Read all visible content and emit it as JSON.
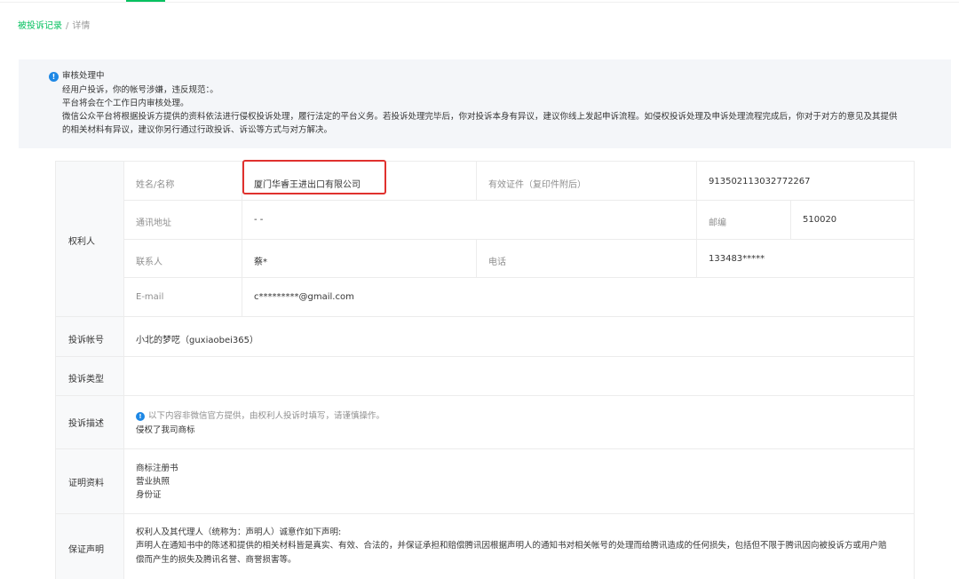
{
  "breadcrumb": {
    "parent": "被投诉记录",
    "separator": "/",
    "current": "详情"
  },
  "notice": {
    "status_title": "审核处理中",
    "line1": "经用户投诉，你的帐号涉嫌，违反规范：。",
    "line2": "平台将会在个工作日内审核处理。",
    "line3": "微信公众平台将根据投诉方提供的资料依法进行侵权投诉处理，履行法定的平台义务。若投诉处理完毕后，你对投诉本身有异议，建议你线上发起申诉流程。如侵权投诉处理及申诉处理流程完成后，你对于对方的意见及其提供",
    "line4": "的相关材料有异议，建议你另行通过行政投诉、诉讼等方式与对方解决。"
  },
  "rights_holder": {
    "section_label": "权利人",
    "name_label": "姓名/名称",
    "name_value": "厦门华睿王进出口有限公司",
    "cert_label": "有效证件（复印件附后）",
    "cert_value": "913502113032772267",
    "address_label": "通讯地址",
    "address_value": "- -",
    "postcode_label": "邮编",
    "postcode_value": "510020",
    "contact_label": "联系人",
    "contact_value": "蔡*",
    "phone_label": "电话",
    "phone_value": "133483*****",
    "email_label": "E-mail",
    "email_value": "c*********@gmail.com"
  },
  "complaint_account": {
    "label": "投诉帐号",
    "value": "小北的梦呓（guxiaobei365）"
  },
  "complaint_type": {
    "label": "投诉类型",
    "value": ""
  },
  "complaint_desc": {
    "label": "投诉描述",
    "hint": "以下内容非微信官方提供，由权利人投诉时填写，请谨慎操作。",
    "value": "侵权了我司商标"
  },
  "evidence": {
    "label": "证明资料",
    "items": [
      "商标注册书",
      "营业执照",
      "身份证"
    ]
  },
  "guarantee": {
    "label": "保证声明",
    "line1": "权利人及其代理人（统称为：声明人）诚意作如下声明:",
    "line2": "声明人在通知书中的陈述和提供的相关材料皆是真实、有效、合法的，并保证承担和赔偿腾讯因根据声明人的通知书对相关帐号的处理而给腾讯造成的任何损失，包括但不限于腾讯因向被投诉方或用户赔",
    "line3": "偿而产生的损失及腾讯名誉、商誉损害等。"
  },
  "colors": {
    "accent": "#07c160",
    "info": "#1e88e5",
    "highlight": "#e0312e"
  }
}
